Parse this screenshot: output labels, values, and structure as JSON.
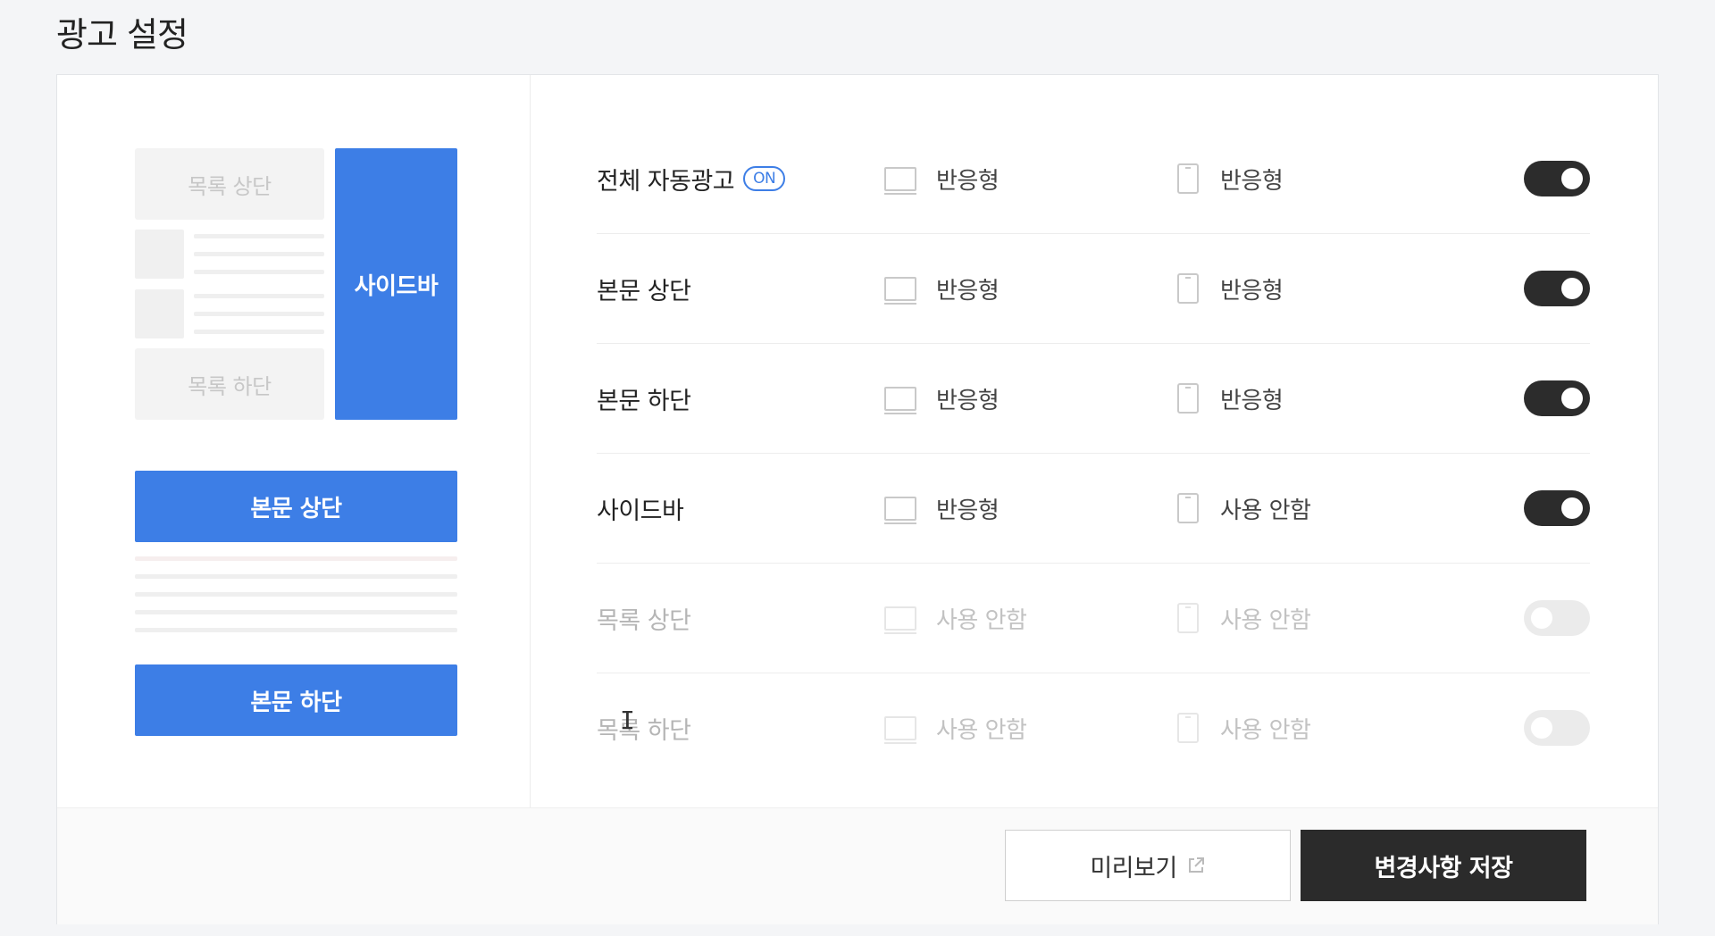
{
  "page": {
    "title": "광고 설정"
  },
  "preview": {
    "list_top": "목록 상단",
    "list_bottom": "목록 하단",
    "sidebar": "사이드바",
    "body_top": "본문 상단",
    "body_bottom": "본문 하단"
  },
  "rows": [
    {
      "label": "전체 자동광고",
      "badge": "ON",
      "pc": "반응형",
      "mobile": "반응형",
      "enabled": true
    },
    {
      "label": "본문 상단",
      "pc": "반응형",
      "mobile": "반응형",
      "enabled": true
    },
    {
      "label": "본문 하단",
      "pc": "반응형",
      "mobile": "반응형",
      "enabled": true
    },
    {
      "label": "사이드바",
      "pc": "반응형",
      "mobile": "사용 안함",
      "enabled": true
    },
    {
      "label": "목록 상단",
      "pc": "사용 안함",
      "mobile": "사용 안함",
      "enabled": false
    },
    {
      "label": "목록 하단",
      "pc": "사용 안함",
      "mobile": "사용 안함",
      "enabled": false
    }
  ],
  "footer": {
    "preview_label": "미리보기",
    "save_label": "변경사항 저장"
  },
  "colors": {
    "accent": "#3d7ee6",
    "toggle_on": "#2c2c2c",
    "toggle_off": "#ebebeb"
  }
}
